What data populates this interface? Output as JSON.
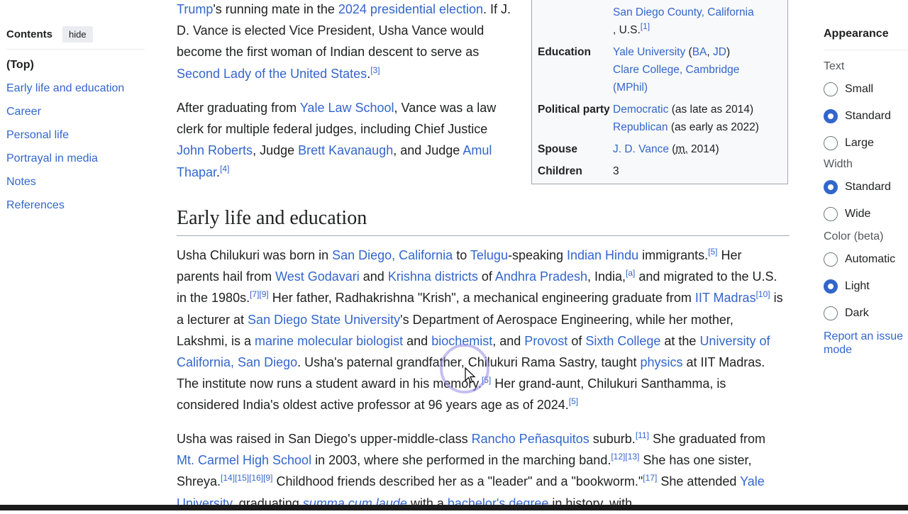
{
  "toc": {
    "title": "Contents",
    "hide_label": "hide",
    "items": [
      "(Top)",
      "Early life and education",
      "Career",
      "Personal life",
      "Portrayal in media",
      "Notes",
      "References"
    ]
  },
  "p1": {
    "l1": "Trump",
    "t1": "'s running mate in the ",
    "l2": "2024 presidential election",
    "t2": ". If J. D. Vance is elected Vice President, Usha Vance would become the first woman of Indian descent to serve as ",
    "l3": "Second Lady of the United States",
    "t3": ".",
    "r1": "[3]"
  },
  "p2": {
    "t1": "After graduating from ",
    "l1": "Yale Law School",
    "t2": ", Vance was a law clerk for multiple federal judges, including Chief Justice ",
    "l2": "John Roberts",
    "t3": ", Judge ",
    "l3": "Brett Kavanaugh",
    "t4": ", and Judge ",
    "l4": "Amul Thapar",
    "t5": ".",
    "r1": "[4]"
  },
  "heading": "Early life and education",
  "p3": {
    "t1": "Usha Chilukuri was born in ",
    "l1": "San Diego, California",
    "t2": " to ",
    "l2": "Telugu",
    "t3": "-speaking ",
    "l3": "Indian Hindu",
    "t4": " immigrants.",
    "r1": "[5]",
    "t5": " Her parents hail from ",
    "l4": "West Godavari",
    "t6": " and ",
    "l5": "Krishna districts",
    "t7": " of ",
    "l6": "Andhra Pradesh",
    "t8": ", India,",
    "r2": "[a]",
    "t9": " and migrated to the U.S. in the 1980s.",
    "r3": "[7]",
    "r4": "[9]",
    "t10": " Her father, Radhakrishna \"Krish\", a mechanical engineering graduate from ",
    "l7": "IIT Madras",
    "r5": "[10]",
    "t11": " is a lecturer at ",
    "l8": "San Diego State University",
    "t12": "'s Department of Aerospace Engineering, while her mother, Lakshmi, is a ",
    "l9": "marine molecular biologist",
    "t13": " and ",
    "l10": "biochemist",
    "t14": ", and ",
    "l11": "Provost",
    "t15": " of ",
    "l12": "Sixth College",
    "t16": " at the ",
    "l13": "University of California, San Diego",
    "t17": ". Usha's paternal grandfather, Chilukuri Rama Sastry, taught ",
    "l14": "physics",
    "t18": " at IIT Madras. The institute now runs a student award in his memory.",
    "r6": "[5]",
    "t19": " Her grand-aunt, Chilukuri Santhamma, is considered India's oldest active professor at 96 years age as of 2024.",
    "r7": "[5]"
  },
  "p4": {
    "t1": "Usha was raised in San Diego's upper-middle-class ",
    "l1": "Rancho Peñasquitos",
    "t2": " suburb.",
    "r1": "[11]",
    "t3": " She graduated from ",
    "l2": "Mt. Carmel High School",
    "t4": " in 2003, where she performed in the marching band.",
    "r2": "[12]",
    "r3": "[13]",
    "t5": " She has one sister, Shreya.",
    "r4": "[14]",
    "r5": "[15]",
    "r6": "[16]",
    "r7": "[9]",
    "t6": " Childhood friends described her as a \"leader\" and a \"bookworm.\"",
    "r8": "[17]",
    "t7": " She attended ",
    "l3": "Yale University",
    "t8": ", graduating ",
    "l4": "summa cum laude",
    "t9": " with a ",
    "l5": "bachelor's degree",
    "t10": " in history, with"
  },
  "infobox": {
    "born_l1": "San Diego County, California",
    "born_t1": ", U.S.",
    "born_r1": "[1]",
    "education_label": "Education",
    "edu_l1": "Yale University",
    "edu_t1": " (",
    "edu_l2": "BA",
    "edu_t2": ", ",
    "edu_l3": "JD",
    "edu_t3": ")",
    "edu_l4": "Clare College, Cambridge",
    "edu_l5": "(MPhil)",
    "party_label": "Political party",
    "party_l1": "Democratic",
    "party_t1": " (as late as 2014)",
    "party_l2": "Republican",
    "party_t2": " (as early as 2022)",
    "spouse_label": "Spouse",
    "spouse_l1": "J. D. Vance",
    "spouse_t1": " (",
    "spouse_m": "m.",
    "spouse_t2": " 2014)",
    "children_label": "Children",
    "children_value": "3"
  },
  "appearance": {
    "title": "Appearance",
    "text_label": "Text",
    "text_options": [
      "Small",
      "Standard",
      "Large"
    ],
    "text_selected": "Standard",
    "width_label": "Width",
    "width_options": [
      "Standard",
      "Wide"
    ],
    "width_selected": "Standard",
    "color_label": "Color (beta)",
    "color_options": [
      "Automatic",
      "Light",
      "Dark"
    ],
    "color_selected": "Light",
    "report_link": "Report an issue mode"
  },
  "colors": {
    "link": "#3366cc",
    "text": "#202122",
    "radio_on": "#3366cc"
  }
}
